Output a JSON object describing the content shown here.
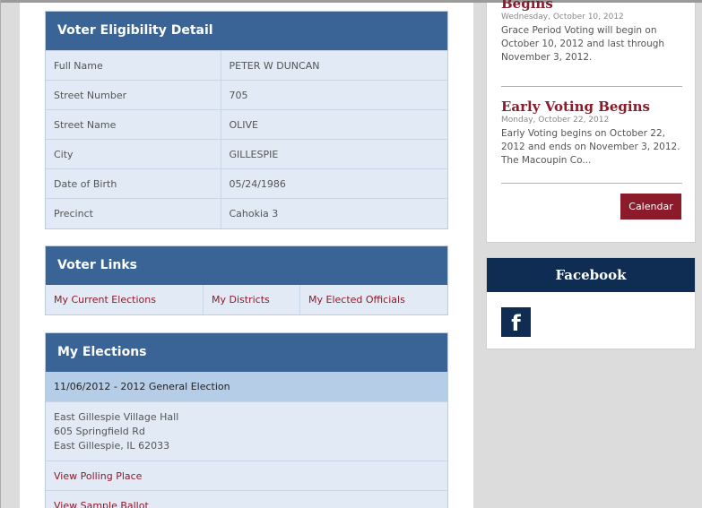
{
  "eligibility": {
    "title": "Voter Eligibility Detail",
    "rows": [
      {
        "label": "Full Name",
        "value": "PETER W DUNCAN"
      },
      {
        "label": "Street Number",
        "value": "705"
      },
      {
        "label": "Street Name",
        "value": "OLIVE"
      },
      {
        "label": "City",
        "value": "GILLESPIE"
      },
      {
        "label": "Date of Birth",
        "value": "05/24/1986"
      },
      {
        "label": "Precinct",
        "value": "Cahokia 3"
      }
    ]
  },
  "voter_links": {
    "title": "Voter Links",
    "links": [
      "My Current Elections",
      "My Districts",
      "My Elected Officials"
    ]
  },
  "my_elections": {
    "title": "My Elections",
    "election": "11/06/2012 - 2012 General Election",
    "address": [
      "East Gillespie Village Hall",
      "605 Springfield Rd",
      "East Gillespie, IL 62033"
    ],
    "view_polling": "View Polling Place",
    "view_ballot": "View Sample Ballot"
  },
  "events": [
    {
      "title": "Begins",
      "date": "Wednesday, October 10, 2012",
      "body": "Grace Period Voting will begin on October 10, 2012 and last through November 3, 2012."
    },
    {
      "title": "Early Voting Begins",
      "date": "Monday, October 22, 2012",
      "body": "Early Voting begins on October 22, 2012 and ends on November 3, 2012. The Macoupin Co..."
    }
  ],
  "calendar_button": "Calendar",
  "facebook": {
    "title": "Facebook",
    "icon": "facebook-icon",
    "glyph": "f"
  },
  "colors": {
    "header_blue": "#3a6496",
    "accent_red": "#8b1a2b",
    "navy": "#0f2d52"
  }
}
